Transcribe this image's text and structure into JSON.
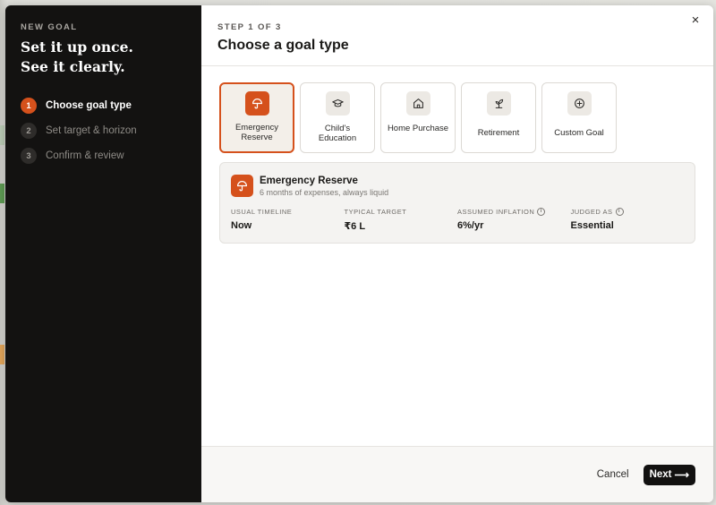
{
  "sidebar": {
    "eyebrow": "NEW GOAL",
    "headline_line1": "Set it up once.",
    "headline_line2": "See it clearly.",
    "steps": [
      {
        "num": "1",
        "label": "Choose goal type"
      },
      {
        "num": "2",
        "label": "Set target & horizon"
      },
      {
        "num": "3",
        "label": "Confirm & review"
      }
    ]
  },
  "header": {
    "step_indicator": "STEP 1 OF 3",
    "title": "Choose a goal type",
    "close_glyph": "×"
  },
  "goal_types": [
    {
      "label": "Emergency Reserve",
      "icon": "umbrella-icon",
      "selected": true
    },
    {
      "label": "Child's Education",
      "icon": "graduation-cap-icon"
    },
    {
      "label": "Home Purchase",
      "icon": "house-icon"
    },
    {
      "label": "Retirement",
      "icon": "sprout-icon"
    },
    {
      "label": "Custom Goal",
      "icon": "plus-circle-icon"
    }
  ],
  "details": {
    "name": "Emergency Reserve",
    "description": "6 months of expenses, always liquid",
    "stats": [
      {
        "key": "USUAL TIMELINE",
        "value": "Now"
      },
      {
        "key": "TYPICAL TARGET",
        "value": "₹6 L"
      },
      {
        "key": "ASSUMED INFLATION",
        "value": "6%/yr"
      },
      {
        "key": "JUDGED AS",
        "value": "Essential"
      }
    ],
    "info_glyph": "i"
  },
  "footer": {
    "cancel_label": "Cancel",
    "next_label": "Next",
    "next_arrow": "⟶"
  },
  "colors": {
    "accent": "#d5511c",
    "sidebar_bg": "#131211",
    "primary_button": "#121110"
  }
}
